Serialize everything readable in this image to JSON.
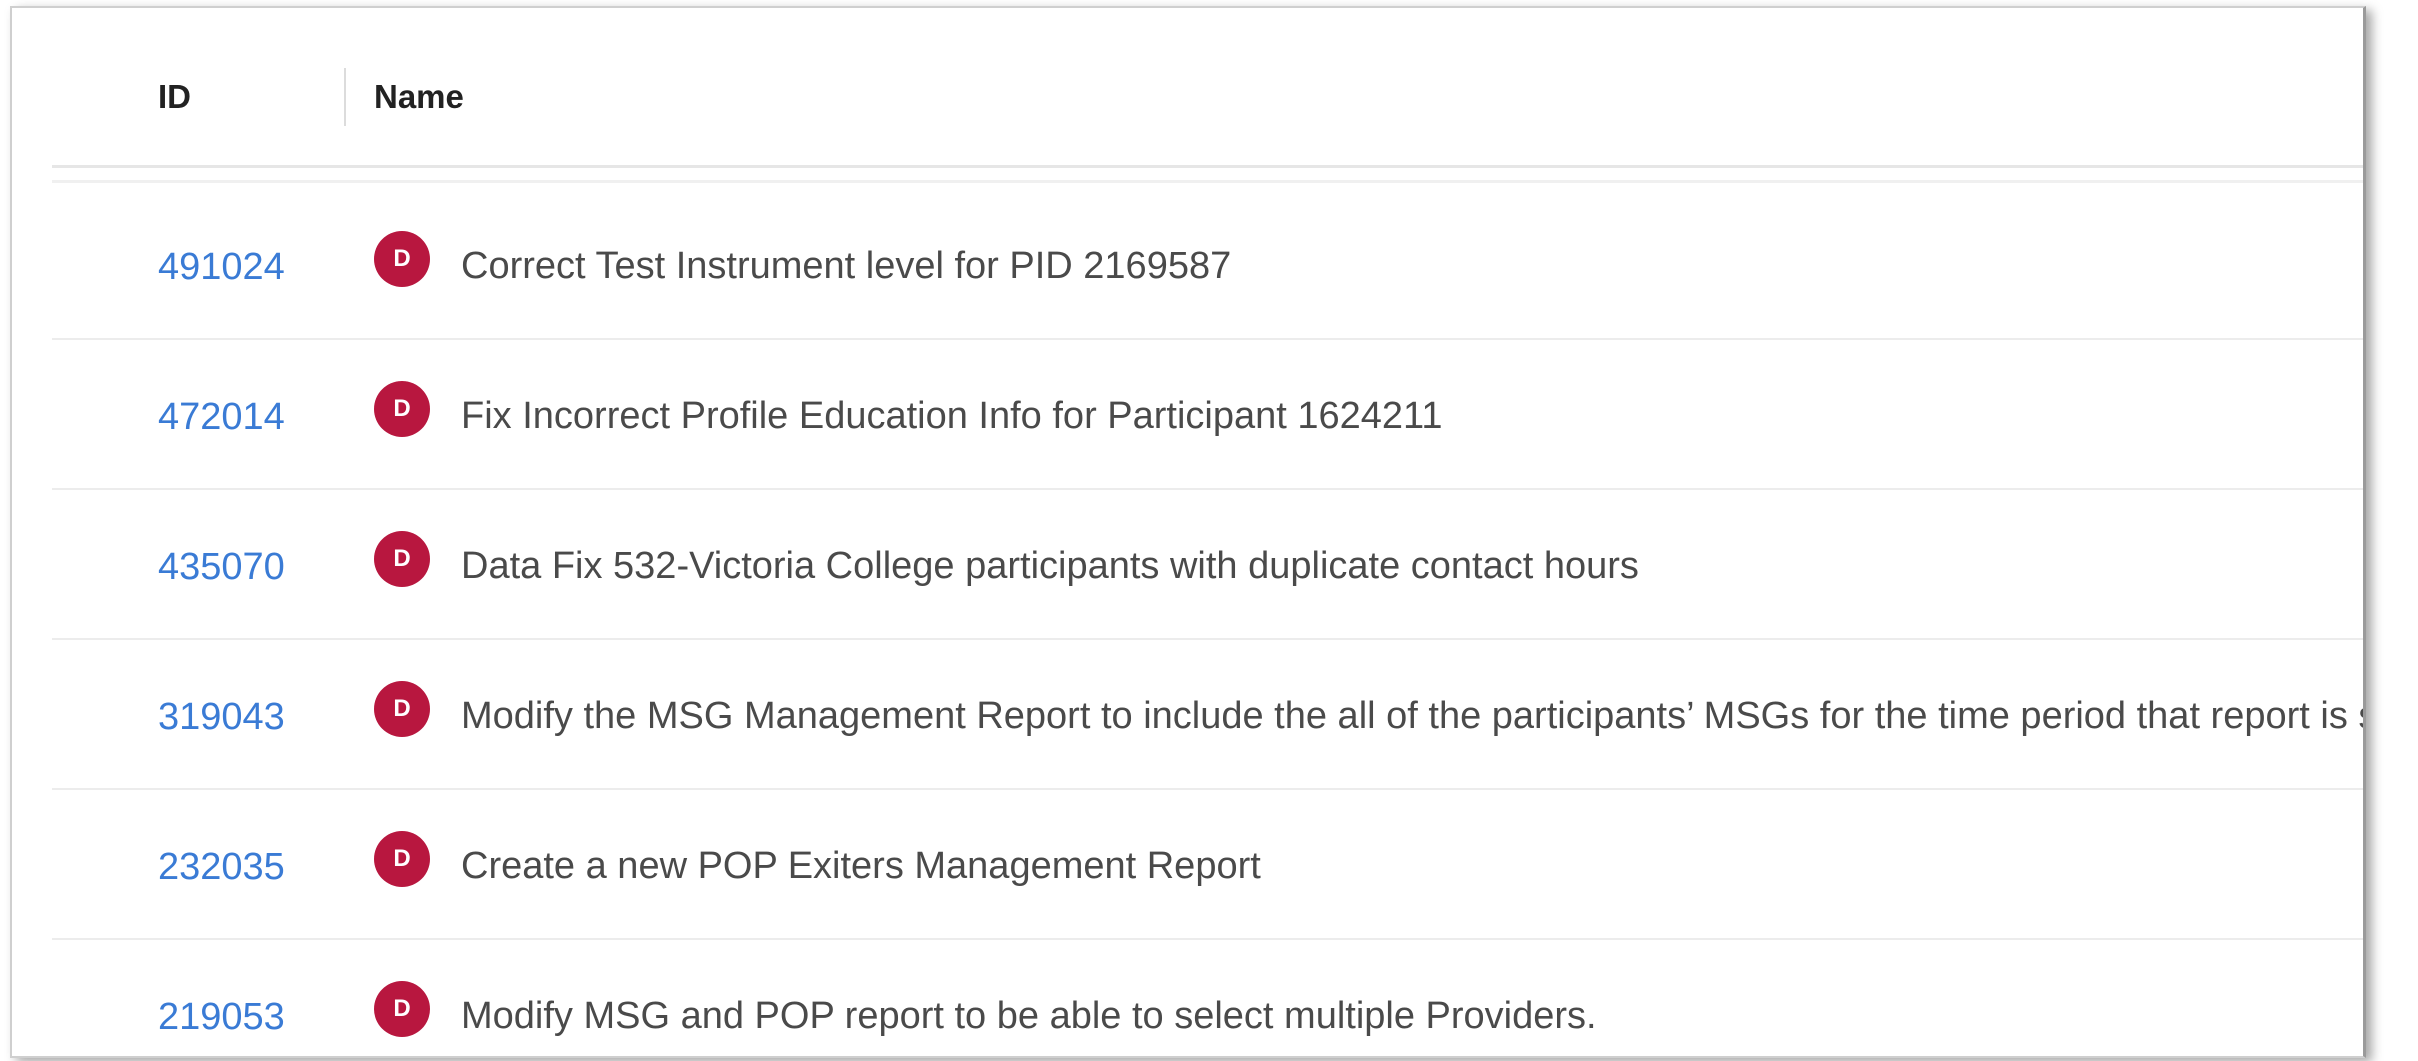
{
  "table": {
    "columns": {
      "id": "ID",
      "name": "Name"
    },
    "rows": [
      {
        "id": "491024",
        "avatar": "D",
        "name": "Correct Test Instrument level for PID 2169587"
      },
      {
        "id": "472014",
        "avatar": "D",
        "name": "Fix Incorrect Profile Education Info for Participant 1624211"
      },
      {
        "id": "435070",
        "avatar": "D",
        "name": "Data Fix 532-Victoria College participants with duplicate contact hours"
      },
      {
        "id": "319043",
        "avatar": "D",
        "name": "Modify the MSG Management Report to include the all of the participants’ MSGs for the time period that report is subm"
      },
      {
        "id": "232035",
        "avatar": "D",
        "name": "Create a new POP Exiters Management Report"
      },
      {
        "id": "219053",
        "avatar": "D",
        "name": "Modify MSG and POP report to be able to select multiple Providers."
      }
    ]
  },
  "colors": {
    "link": "#3a7bd5",
    "avatar": "#b8173f"
  }
}
